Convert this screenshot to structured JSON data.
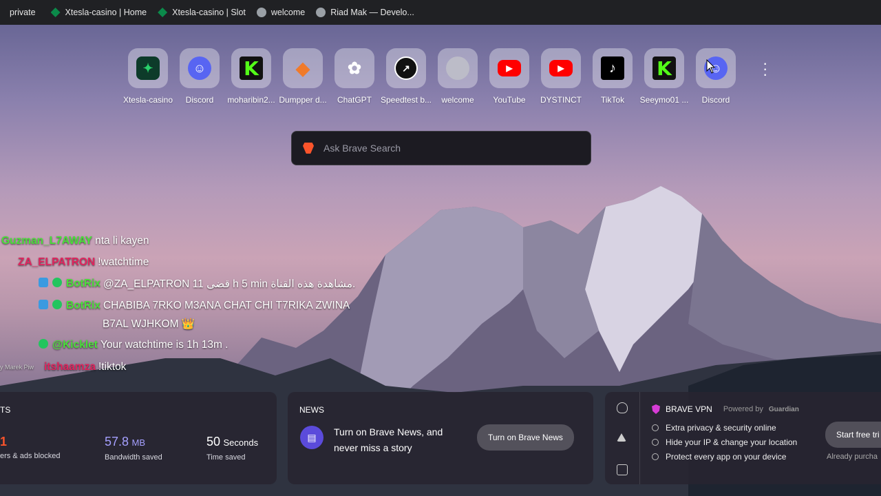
{
  "bookmarks_bar": [
    {
      "label": "private",
      "icon": "globe-icon"
    },
    {
      "label": "Xtesla-casino | Home",
      "icon": "xtesla-icon"
    },
    {
      "label": "Xtesla-casino | Slot",
      "icon": "xtesla-icon"
    },
    {
      "label": "welcome",
      "icon": "globe-icon"
    },
    {
      "label": "Riad Mak — Develo...",
      "icon": "globe-icon"
    }
  ],
  "top_sites": [
    {
      "label": "Xtesla-casino",
      "icon": "xtesla-icon"
    },
    {
      "label": "Discord",
      "icon": "discord-icon"
    },
    {
      "label": "moharibin2...",
      "icon": "kick-icon"
    },
    {
      "label": "Dumpper d...",
      "icon": "dumpper-icon"
    },
    {
      "label": "ChatGPT",
      "icon": "chatgpt-icon"
    },
    {
      "label": "Speedtest b...",
      "icon": "speedtest-icon"
    },
    {
      "label": "welcome",
      "icon": "globe-icon"
    },
    {
      "label": "YouTube",
      "icon": "youtube-icon"
    },
    {
      "label": "DYSTINCT",
      "icon": "youtube-icon"
    },
    {
      "label": "TikTok",
      "icon": "tiktok-icon"
    },
    {
      "label": "Seeymo01 ...",
      "icon": "kick-icon"
    },
    {
      "label": "Discord",
      "icon": "discord-icon"
    }
  ],
  "search": {
    "placeholder": "Ask Brave Search"
  },
  "chat": [
    {
      "user": "Guzman_L7AWAY",
      "text": "nta li kayen",
      "color": "#4ade3a"
    },
    {
      "user": "ZA_ELPATRON",
      "text": "!watchtime",
      "color": "#e0245e"
    },
    {
      "user": "BotRix",
      "text": "@ZA_ELPATRON 11 قضى h 5 min مشاهدة هذه القناة.",
      "color": "#4ade3a"
    },
    {
      "user": "BotRix",
      "text": "CHABIBA 7RKO M3ANA CHAT CHI T7RIKA ZWINA",
      "text2": "B7AL WJHKOM 👑",
      "color": "#4ade3a"
    },
    {
      "user": "@Kicklet",
      "text": "Your watchtime is 1h 13m .",
      "color": "#4ade3a"
    },
    {
      "user": "itshaamza",
      "text": "!tiktok",
      "color": "#e0245e"
    }
  ],
  "watermark": "y Marek Piw",
  "stats": {
    "title": "TS",
    "trackers_value": "1",
    "trackers_label": "ers & ads blocked",
    "bandwidth_value": "57.8",
    "bandwidth_unit": "MB",
    "bandwidth_label": "Bandwidth saved",
    "time_value": "50",
    "time_unit": "Seconds",
    "time_label": "Time saved"
  },
  "news": {
    "title": "NEWS",
    "line1": "Turn on Brave News, and",
    "line2": "never miss a story",
    "button": "Turn on Brave News"
  },
  "vpn": {
    "title": "BRAVE VPN",
    "powered": "Powered by",
    "powered_brand": "Guardian",
    "features": [
      "Extra privacy & security online",
      "Hide your IP & change your location",
      "Protect every app on your device"
    ],
    "button": "Start free tri",
    "already": "Already purcha"
  },
  "colors": {
    "brave_orange": "#fb542b",
    "kick_green": "#53fc18",
    "discord": "#5865f2",
    "youtube": "#ff0000"
  }
}
